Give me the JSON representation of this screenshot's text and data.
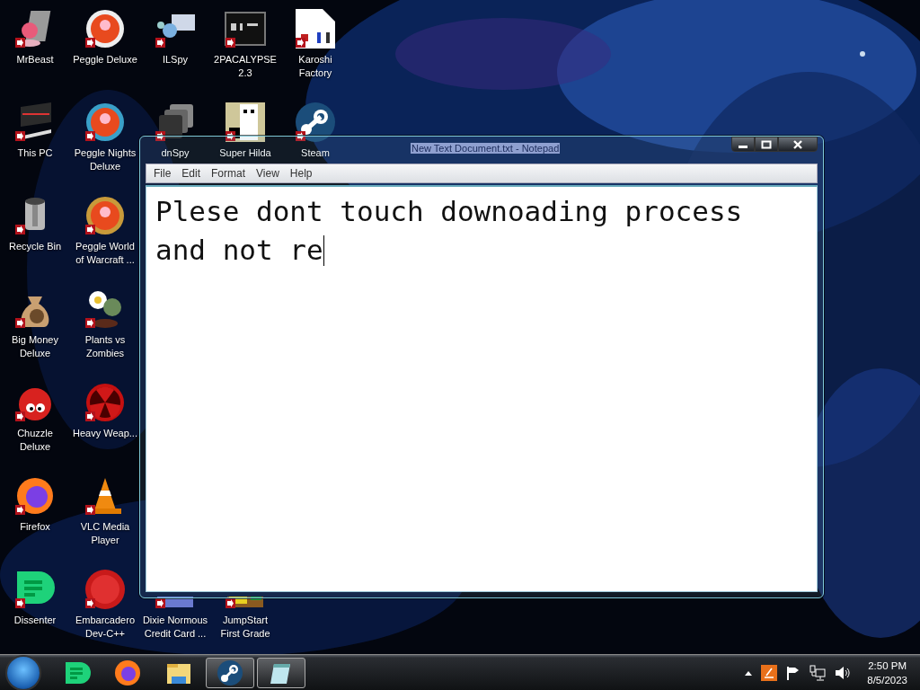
{
  "desktop": {
    "columns": [
      {
        "items": [
          "MrBeast",
          "This PC",
          "Recycle Bin",
          "Big Money Deluxe",
          "Chuzzle Deluxe",
          "Firefox",
          "Dissenter"
        ]
      },
      {
        "items": [
          "Peggle Deluxe",
          "Peggle Nights Deluxe",
          "Peggle World of Warcraft ...",
          "Plants vs Zombies",
          "Heavy Weap...",
          "VLC Media Player",
          "Embarcadero Dev-C++"
        ]
      },
      {
        "items": [
          "ILSpy",
          "dnSpy"
        ],
        "bottom_items": [
          "Dixie Normous Credit Card ..."
        ]
      },
      {
        "items": [
          "2PACALYPSE 2.3",
          "Super Hilda"
        ],
        "bottom_items": [
          "JumpStart First Grade"
        ]
      },
      {
        "items": [
          "Karoshi Factory",
          "Steam"
        ]
      }
    ]
  },
  "window": {
    "title": "New Text Document.txt - Notepad",
    "title_selected": true,
    "menu": [
      "File",
      "Edit",
      "Format",
      "View",
      "Help"
    ],
    "lines": [
      "Plese dont touch downoading process",
      "and not re"
    ]
  },
  "taskbar": {
    "items": [
      {
        "running": false
      },
      {
        "running": false
      },
      {
        "running": false
      },
      {
        "running": true
      },
      {
        "running": true
      }
    ],
    "clock": {
      "time": "2:50 PM",
      "date": "8/5/2023"
    }
  }
}
